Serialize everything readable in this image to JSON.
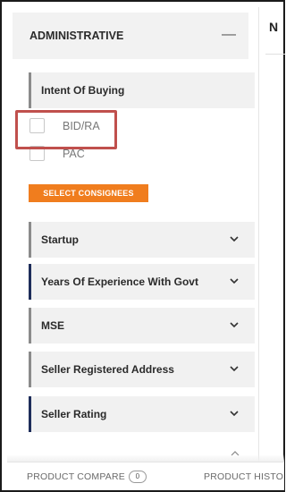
{
  "sidebar": {
    "header": {
      "title": "ADMINISTRATIVE",
      "toggle": "—"
    },
    "intent_section": {
      "title": "Intent Of Buying",
      "options": [
        {
          "label": "BID/RA",
          "checked": false
        },
        {
          "label": "PAC",
          "checked": false
        }
      ]
    },
    "select_consignees_label": "SELECT CONSIGNEES",
    "filters": [
      {
        "label": "Startup"
      },
      {
        "label": "Years Of Experience With Govt"
      },
      {
        "label": "MSE"
      },
      {
        "label": "Seller Registered Address"
      },
      {
        "label": "Seller Rating"
      }
    ]
  },
  "main": {
    "title_fragment": "N"
  },
  "bottom_bar": {
    "product_compare_label": "PRODUCT COMPARE",
    "product_compare_count": "0",
    "product_history_label": "PRODUCT HISTO"
  },
  "colors": {
    "accent_orange": "#f07d1e",
    "highlight_red": "#c0504d",
    "section_bg": "#f1f1f1",
    "dark_navy_marker": "#1e2d5a"
  }
}
